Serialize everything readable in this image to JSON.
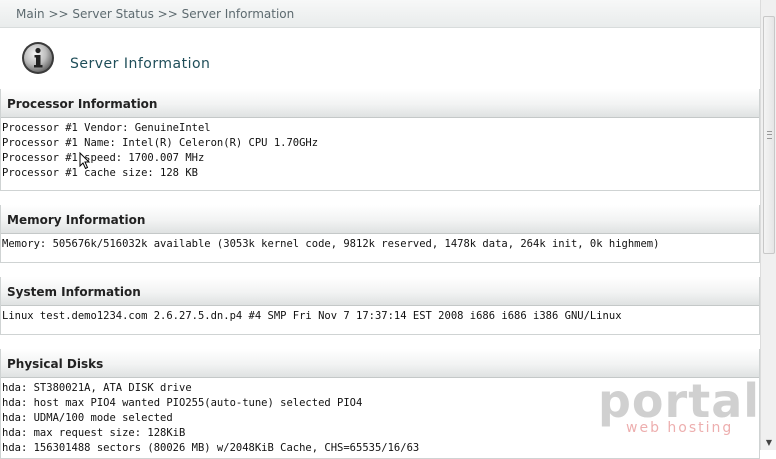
{
  "breadcrumb": {
    "items": [
      "Main",
      "Server Status",
      "Server Information"
    ],
    "separator": ">>"
  },
  "header": {
    "icon": "info-icon",
    "title": "Server Information"
  },
  "sections": [
    {
      "title": "Processor Information",
      "lines": [
        "Processor #1 Vendor: GenuineIntel",
        "Processor #1 Name: Intel(R) Celeron(R) CPU 1.70GHz",
        "Processor #1 speed: 1700.007 MHz",
        "Processor #1 cache size: 128 KB"
      ]
    },
    {
      "title": "Memory Information",
      "lines": [
        "Memory: 505676k/516032k available (3053k kernel code, 9812k reserved, 1478k data, 264k init, 0k highmem)"
      ]
    },
    {
      "title": "System Information",
      "lines": [
        "Linux test.demo1234.com 2.6.27.5.dn.p4 #4 SMP Fri Nov 7 17:37:14 EST 2008 i686 i686 i386 GNU/Linux"
      ]
    },
    {
      "title": "Physical Disks",
      "lines": [
        "hda: ST380021A, ATA DISK drive",
        "hda: host max PIO4 wanted PIO255(auto-tune) selected PIO4",
        "hda: UDMA/100 mode selected",
        "hda: max request size: 128KiB",
        "hda: 156301488 sectors (80026 MB) w/2048KiB Cache, CHS=65535/16/63"
      ]
    }
  ],
  "watermark": {
    "main": "portal",
    "sub": "web hosting"
  },
  "colors": {
    "title": "#1f4e59",
    "watermark_main": "#969696",
    "watermark_sub": "#e17878"
  }
}
